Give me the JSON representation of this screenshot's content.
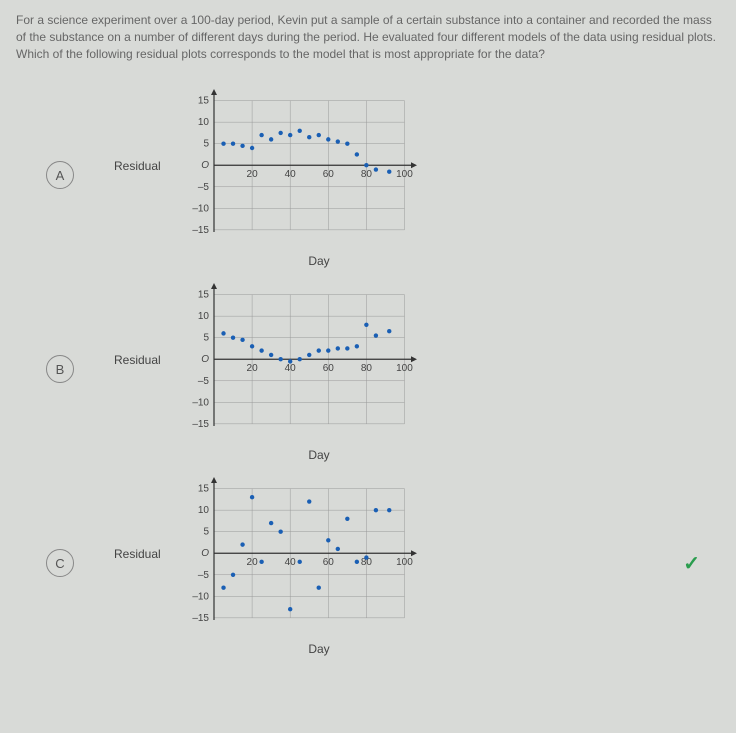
{
  "question": "For a science experiment over a 100-day period, Kevin put a sample of a certain substance into a container and recorded the mass of the substance on a number of different days during the period. He evaluated four different models of the data using residual plots. Which of the following residual plots corresponds to the model that is most appropriate for the data?",
  "options": [
    {
      "label": "A"
    },
    {
      "label": "B"
    },
    {
      "label": "C"
    }
  ],
  "axis": {
    "y_label": "Residual",
    "x_label": "Day",
    "y_ticks": [
      15,
      10,
      5,
      0,
      -5,
      -10,
      -15
    ],
    "x_ticks": [
      20,
      40,
      60,
      80,
      100
    ]
  },
  "chart_data": [
    {
      "type": "scatter",
      "option": "A",
      "xlabel": "Day",
      "ylabel": "Residual",
      "xlim": [
        0,
        105
      ],
      "ylim": [
        -15,
        15
      ],
      "points": [
        {
          "x": 5,
          "y": 5
        },
        {
          "x": 10,
          "y": 5
        },
        {
          "x": 15,
          "y": 4.5
        },
        {
          "x": 20,
          "y": 4
        },
        {
          "x": 25,
          "y": 7
        },
        {
          "x": 30,
          "y": 6
        },
        {
          "x": 35,
          "y": 7.5
        },
        {
          "x": 40,
          "y": 7
        },
        {
          "x": 45,
          "y": 8
        },
        {
          "x": 50,
          "y": 6.5
        },
        {
          "x": 55,
          "y": 7
        },
        {
          "x": 60,
          "y": 6
        },
        {
          "x": 65,
          "y": 5.5
        },
        {
          "x": 70,
          "y": 5
        },
        {
          "x": 75,
          "y": 2.5
        },
        {
          "x": 80,
          "y": 0
        },
        {
          "x": 85,
          "y": -1
        },
        {
          "x": 92,
          "y": -1.5
        }
      ]
    },
    {
      "type": "scatter",
      "option": "B",
      "xlabel": "Day",
      "ylabel": "Residual",
      "xlim": [
        0,
        105
      ],
      "ylim": [
        -15,
        15
      ],
      "points": [
        {
          "x": 5,
          "y": 6
        },
        {
          "x": 10,
          "y": 5
        },
        {
          "x": 15,
          "y": 4.5
        },
        {
          "x": 20,
          "y": 3
        },
        {
          "x": 25,
          "y": 2
        },
        {
          "x": 30,
          "y": 1
        },
        {
          "x": 35,
          "y": 0
        },
        {
          "x": 40,
          "y": -0.5
        },
        {
          "x": 45,
          "y": 0
        },
        {
          "x": 50,
          "y": 1
        },
        {
          "x": 55,
          "y": 2
        },
        {
          "x": 60,
          "y": 2
        },
        {
          "x": 65,
          "y": 2.5
        },
        {
          "x": 70,
          "y": 2.5
        },
        {
          "x": 75,
          "y": 3
        },
        {
          "x": 80,
          "y": 8
        },
        {
          "x": 85,
          "y": 5.5
        },
        {
          "x": 92,
          "y": 6.5
        }
      ]
    },
    {
      "type": "scatter",
      "option": "C",
      "xlabel": "Day",
      "ylabel": "Residual",
      "xlim": [
        0,
        105
      ],
      "ylim": [
        -15,
        15
      ],
      "points": [
        {
          "x": 5,
          "y": -8
        },
        {
          "x": 10,
          "y": -5
        },
        {
          "x": 15,
          "y": 2
        },
        {
          "x": 20,
          "y": 13
        },
        {
          "x": 25,
          "y": -2
        },
        {
          "x": 30,
          "y": 7
        },
        {
          "x": 35,
          "y": 5
        },
        {
          "x": 40,
          "y": -13
        },
        {
          "x": 45,
          "y": -2
        },
        {
          "x": 50,
          "y": 12
        },
        {
          "x": 55,
          "y": -8
        },
        {
          "x": 60,
          "y": 3
        },
        {
          "x": 65,
          "y": 1
        },
        {
          "x": 70,
          "y": 8
        },
        {
          "x": 75,
          "y": -2
        },
        {
          "x": 80,
          "y": -1
        },
        {
          "x": 85,
          "y": 10
        },
        {
          "x": 92,
          "y": 10
        }
      ],
      "correct": true
    }
  ]
}
